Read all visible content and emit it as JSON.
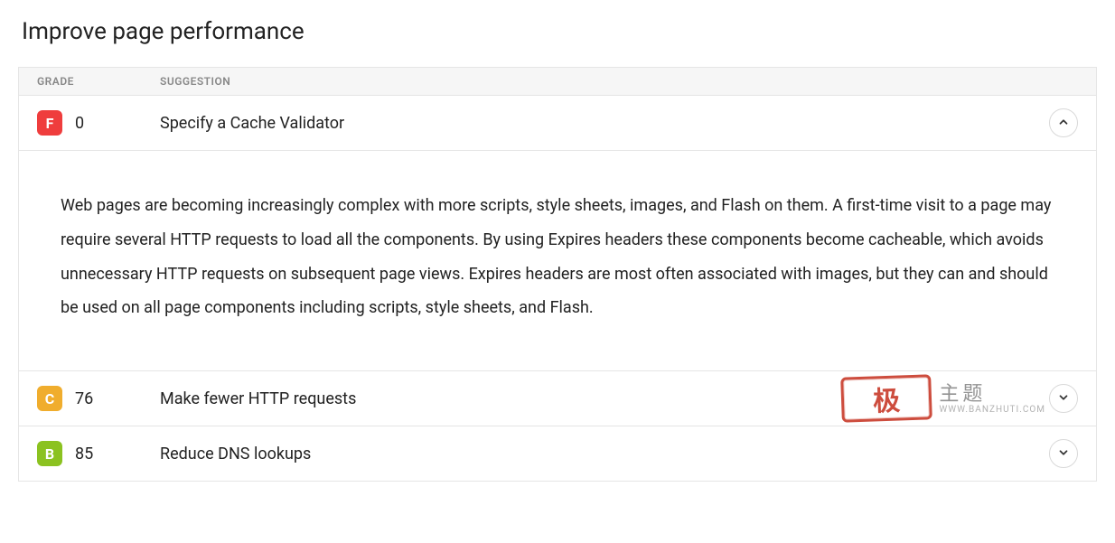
{
  "title": "Improve page performance",
  "columns": {
    "grade": "GRADE",
    "suggestion": "SUGGESTION"
  },
  "rows": [
    {
      "grade_letter": "F",
      "grade_class": "grade-F",
      "score": "0",
      "suggestion": "Specify a Cache Validator",
      "expanded": true,
      "details": "Web pages are becoming increasingly complex with more scripts, style sheets, images, and Flash on them. A first-time visit to a page may require several HTTP requests to load all the components. By using Expires headers these components become cacheable, which avoids unnecessary HTTP requests on subsequent page views. Expires headers are most often associated with images, but they can and should be used on all page components including scripts, style sheets, and Flash."
    },
    {
      "grade_letter": "C",
      "grade_class": "grade-C",
      "score": "76",
      "suggestion": "Make fewer HTTP requests",
      "expanded": false
    },
    {
      "grade_letter": "B",
      "grade_class": "grade-B",
      "score": "85",
      "suggestion": "Reduce DNS lookups",
      "expanded": false
    }
  ],
  "watermark": {
    "stamp": "极",
    "line1": "主题",
    "line2": "WWW.BANZHUTI.COM"
  }
}
